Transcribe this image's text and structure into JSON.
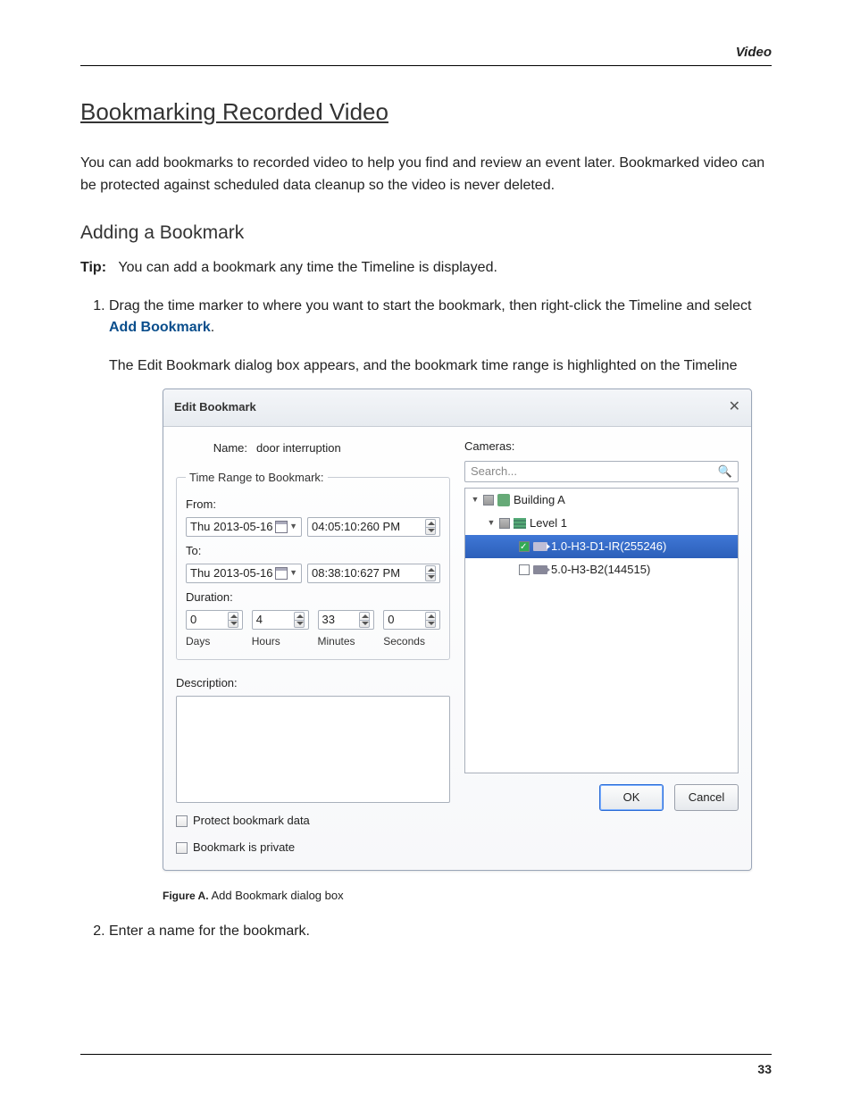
{
  "header": {
    "section": "Video"
  },
  "title": "Bookmarking Recorded Video",
  "intro": "You can add bookmarks to recorded video to help you find and review an event later. Bookmarked video can be protected against scheduled data cleanup so the video is never deleted.",
  "sub1": "Adding a Bookmark",
  "tip_label": "Tip:",
  "tip_text": "You can add a bookmark any time the Timeline is displayed.",
  "step1a": "Drag the time marker to where you want to start the bookmark, then right-click the Timeline and select ",
  "step1_link": "Add Bookmark",
  "step1b": ".",
  "step1_sub": "The Edit Bookmark dialog box appears, and the bookmark time range is highlighted on the Timeline",
  "dialog": {
    "title": "Edit Bookmark",
    "name_label": "Name:",
    "name_value": "door interruption",
    "range_legend": "Time Range to Bookmark:",
    "from_label": "From:",
    "from_date": "Thu 2013-05-16",
    "from_time": "04:05:10:260 PM",
    "to_label": "To:",
    "to_date": "Thu 2013-05-16",
    "to_time": "08:38:10:627 PM",
    "duration_label": "Duration:",
    "d_days": "0",
    "d_hours": "4",
    "d_min": "33",
    "d_sec": "0",
    "l_days": "Days",
    "l_hours": "Hours",
    "l_min": "Minutes",
    "l_sec": "Seconds",
    "desc_label": "Description:",
    "protect_label": "Protect bookmark data",
    "private_label": "Bookmark is private",
    "cameras_label": "Cameras:",
    "search_placeholder": "Search...",
    "tree": {
      "site": "Building A",
      "level": "Level 1",
      "cam1": "1.0-H3-D1-IR(255246)",
      "cam2": "5.0-H3-B2(144515)"
    },
    "ok": "OK",
    "cancel": "Cancel"
  },
  "fig_label": "Figure A.",
  "fig_caption": "Add Bookmark dialog box",
  "step2": "Enter a name for the bookmark.",
  "page_number": "33"
}
